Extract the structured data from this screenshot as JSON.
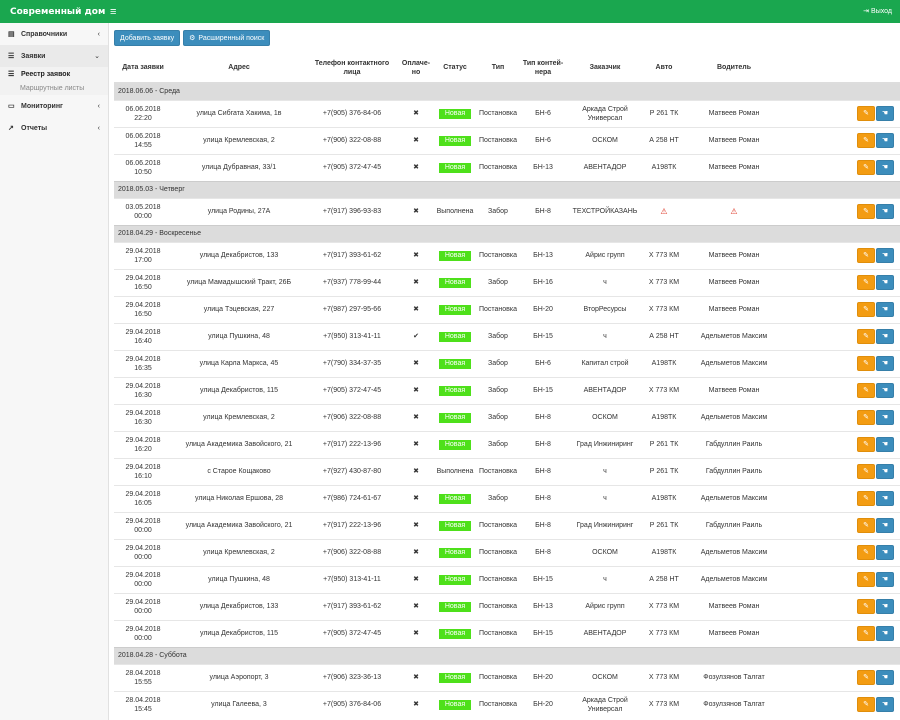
{
  "app": {
    "title": "Современный дом",
    "logout": "Выход"
  },
  "sidebar": {
    "items": [
      {
        "label": "Справочники",
        "icon": "book-icon"
      },
      {
        "label": "Заявки",
        "icon": "list-icon",
        "open": true
      },
      {
        "label": "Мониторинг",
        "icon": "monitor-icon"
      },
      {
        "label": "Отчеты",
        "icon": "chart-icon"
      }
    ],
    "sub": {
      "active": "Реестр заявок",
      "muted": "Маршрутные листы"
    }
  },
  "toolbar": {
    "add_label": "Добавить заявку",
    "search_label": "Расширенный поиск"
  },
  "table": {
    "headers": [
      "Дата заявки",
      "Адрес",
      "Телефон контактного лица",
      "Оплаче-но",
      "Статус",
      "Тип",
      "Тип контей-нера",
      "Заказчик",
      "Авто",
      "Водитель",
      ""
    ],
    "groups": [
      {
        "title": "2018.06.06 - Среда",
        "rows": [
          {
            "date": "06.06.2018",
            "time": "22:20",
            "addr": "улица Сибгата Хакима, 1в",
            "phone": "+7(905) 376-84-06",
            "paid": "✖",
            "status": "Новая",
            "type": "Постановка",
            "cont": "БН-6",
            "cust": "Аркада Строй Универсал",
            "auto": "Р 261 ТК",
            "driver": "Матвеев Роман"
          },
          {
            "date": "06.06.2018",
            "time": "14:55",
            "addr": "улица Кремлевская, 2",
            "phone": "+7(906) 322-08-88",
            "paid": "✖",
            "status": "Новая",
            "type": "Постановка",
            "cont": "БН-6",
            "cust": "ОСКОМ",
            "auto": "А 258 НТ",
            "driver": "Матвеев Роман"
          },
          {
            "date": "06.06.2018",
            "time": "10:50",
            "addr": "улица Дубравная, 33/1",
            "phone": "+7(905) 372-47-45",
            "paid": "✖",
            "status": "Новая",
            "type": "Постановка",
            "cont": "БН-13",
            "cust": "АВЕНТАДОР",
            "auto": "А198ТК",
            "driver": "Матвеев Роман"
          }
        ]
      },
      {
        "title": "2018.05.03 - Четверг",
        "rows": [
          {
            "date": "03.05.2018",
            "time": "00:00",
            "addr": "улица Родины, 27А",
            "phone": "+7(917) 396-93-83",
            "paid": "✖",
            "status": "Выполнена",
            "type": "Забор",
            "cont": "БН-8",
            "cust": "ТЕХСТРОЙКАЗАНЬ",
            "auto": "⚠",
            "driver": "⚠"
          }
        ]
      },
      {
        "title": "2018.04.29 - Воскресенье",
        "rows": [
          {
            "date": "29.04.2018",
            "time": "17:00",
            "addr": "улица Декабристов, 133",
            "phone": "+7(917) 393-61-62",
            "paid": "✖",
            "status": "Новая",
            "type": "Постановка",
            "cont": "БН-13",
            "cust": "Айрис групп",
            "auto": "Х 773 КМ",
            "driver": "Матвеев Роман"
          },
          {
            "date": "29.04.2018",
            "time": "16:50",
            "addr": "улица Мамадышский Тракт, 26Б",
            "phone": "+7(937) 778-99-44",
            "paid": "✖",
            "status": "Новая",
            "type": "Забор",
            "cont": "БН-16",
            "cust": "ч",
            "auto": "Х 773 КМ",
            "driver": "Матвеев Роман"
          },
          {
            "date": "29.04.2018",
            "time": "16:50",
            "addr": "улица Тэцевская, 227",
            "phone": "+7(987) 297-95-66",
            "paid": "✖",
            "status": "Новая",
            "type": "Постановка",
            "cont": "БН-20",
            "cust": "ВторРесурсы",
            "auto": "Х 773 КМ",
            "driver": "Матвеев Роман"
          },
          {
            "date": "29.04.2018",
            "time": "16:40",
            "addr": "улица Пушкина, 48",
            "phone": "+7(950) 313-41-11",
            "paid": "✔",
            "status": "Новая",
            "type": "Забор",
            "cont": "БН-15",
            "cust": "ч",
            "auto": "А 258 НТ",
            "driver": "Адельметов Максим"
          },
          {
            "date": "29.04.2018",
            "time": "16:35",
            "addr": "улица Карла Маркса, 45",
            "phone": "+7(790) 334-37-35",
            "paid": "✖",
            "status": "Новая",
            "type": "Забор",
            "cont": "БН-6",
            "cust": "Капитал строй",
            "auto": "А198ТК",
            "driver": "Адельметов Максим"
          },
          {
            "date": "29.04.2018",
            "time": "16:30",
            "addr": "улица Декабристов, 115",
            "phone": "+7(905) 372-47-45",
            "paid": "✖",
            "status": "Новая",
            "type": "Забор",
            "cont": "БН-15",
            "cust": "АВЕНТАДОР",
            "auto": "Х 773 КМ",
            "driver": "Матвеев Роман"
          },
          {
            "date": "29.04.2018",
            "time": "16:30",
            "addr": "улица Кремлевская, 2",
            "phone": "+7(906) 322-08-88",
            "paid": "✖",
            "status": "Новая",
            "type": "Забор",
            "cont": "БН-8",
            "cust": "ОСКОМ",
            "auto": "А198ТК",
            "driver": "Адельметов Максим"
          },
          {
            "date": "29.04.2018",
            "time": "16:20",
            "addr": "улица Академика Завойского, 21",
            "phone": "+7(917) 222-13-96",
            "paid": "✖",
            "status": "Новая",
            "type": "Забор",
            "cont": "БН-8",
            "cust": "Град Инжиниринг",
            "auto": "Р 261 ТК",
            "driver": "Габдуллин Раиль"
          },
          {
            "date": "29.04.2018",
            "time": "16:10",
            "addr": "с Старое Кощаково",
            "phone": "+7(927) 430-87-80",
            "paid": "✖",
            "status": "Выполнена",
            "type": "Постановка",
            "cont": "БН-8",
            "cust": "ч",
            "auto": "Р 261 ТК",
            "driver": "Габдуллин Раиль"
          },
          {
            "date": "29.04.2018",
            "time": "16:05",
            "addr": "улица Николая Ершова, 28",
            "phone": "+7(986) 724-61-67",
            "paid": "✖",
            "status": "Новая",
            "type": "Забор",
            "cont": "БН-8",
            "cust": "ч",
            "auto": "А198ТК",
            "driver": "Адельметов Максим"
          },
          {
            "date": "29.04.2018",
            "time": "00:00",
            "addr": "улица Академика Завойского, 21",
            "phone": "+7(917) 222-13-96",
            "paid": "✖",
            "status": "Новая",
            "type": "Постановка",
            "cont": "БН-8",
            "cust": "Град Инжиниринг",
            "auto": "Р 261 ТК",
            "driver": "Габдуллин Раиль"
          },
          {
            "date": "29.04.2018",
            "time": "00:00",
            "addr": "улица Кремлевская, 2",
            "phone": "+7(906) 322-08-88",
            "paid": "✖",
            "status": "Новая",
            "type": "Постановка",
            "cont": "БН-8",
            "cust": "ОСКОМ",
            "auto": "А198ТК",
            "driver": "Адельметов Максим"
          },
          {
            "date": "29.04.2018",
            "time": "00:00",
            "addr": "улица Пушкина, 48",
            "phone": "+7(950) 313-41-11",
            "paid": "✖",
            "status": "Новая",
            "type": "Постановка",
            "cont": "БН-15",
            "cust": "ч",
            "auto": "А 258 НТ",
            "driver": "Адельметов Максим"
          },
          {
            "date": "29.04.2018",
            "time": "00:00",
            "addr": "улица Декабристов, 133",
            "phone": "+7(917) 393-61-62",
            "paid": "✖",
            "status": "Новая",
            "type": "Постановка",
            "cont": "БН-13",
            "cust": "Айрис групп",
            "auto": "Х 773 КМ",
            "driver": "Матвеев Роман"
          },
          {
            "date": "29.04.2018",
            "time": "00:00",
            "addr": "улица Декабристов, 115",
            "phone": "+7(905) 372-47-45",
            "paid": "✖",
            "status": "Новая",
            "type": "Постановка",
            "cont": "БН-15",
            "cust": "АВЕНТАДОР",
            "auto": "Х 773 КМ",
            "driver": "Матвеев Роман"
          }
        ]
      },
      {
        "title": "2018.04.28 - Суббота",
        "rows": [
          {
            "date": "28.04.2018",
            "time": "15:55",
            "addr": "улица Аэропорт, 3",
            "phone": "+7(906) 323-36-13",
            "paid": "✖",
            "status": "Новая",
            "type": "Постановка",
            "cont": "БН-20",
            "cust": "ОСКОМ",
            "auto": "Х 773 КМ",
            "driver": "Фозулзянов Талгат"
          },
          {
            "date": "28.04.2018",
            "time": "15:45",
            "addr": "улица Галеева, 3",
            "phone": "+7(905) 376-84-06",
            "paid": "✖",
            "status": "Новая",
            "type": "Постановка",
            "cont": "БН-20",
            "cust": "Аркада Строй Универсал",
            "auto": "Х 773 КМ",
            "driver": "Фозулзянов Талгат"
          }
        ]
      }
    ]
  },
  "actions": {
    "edit_icon": "pencil-icon",
    "view_icon": "hand-icon"
  },
  "colors": {
    "brand": "#1aa74f",
    "status_new": "#4ee01a",
    "btn_edit": "#f39c12",
    "btn_view": "#3c8dbc"
  }
}
